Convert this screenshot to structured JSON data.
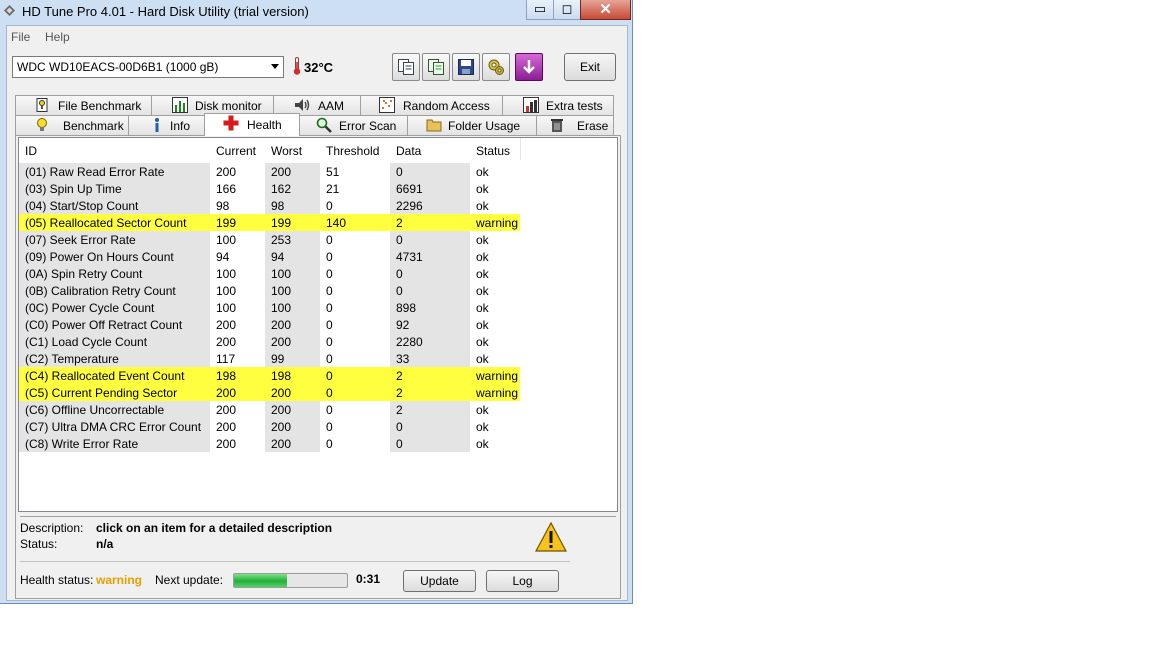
{
  "window": {
    "title": "HD Tune Pro 4.01 - Hard Disk Utility (trial version)"
  },
  "menu": {
    "file": "File",
    "help": "Help"
  },
  "toolbar": {
    "drive": "WDC WD10EACS-00D6B1 (1000 gB)",
    "temperature": "32°C",
    "exit_label": "Exit",
    "icons": [
      "copy-text-icon",
      "copy-info-icon",
      "save-icon",
      "options-icon",
      "screenshot-icon"
    ]
  },
  "tabs": {
    "top": [
      "File Benchmark",
      "Disk monitor",
      "AAM",
      "Random Access",
      "Extra tests"
    ],
    "bottom": [
      "Benchmark",
      "Info",
      "Health",
      "Error Scan",
      "Folder Usage",
      "Erase"
    ],
    "active": "Health"
  },
  "health": {
    "columns": [
      "ID",
      "Current",
      "Worst",
      "Threshold",
      "Data",
      "Status"
    ],
    "rows": [
      [
        "(01) Raw Read Error Rate",
        "200",
        "200",
        "51",
        "0",
        "ok"
      ],
      [
        "(03) Spin Up Time",
        "166",
        "162",
        "21",
        "6691",
        "ok"
      ],
      [
        "(04) Start/Stop Count",
        "98",
        "98",
        "0",
        "2296",
        "ok"
      ],
      [
        "(05) Reallocated Sector Count",
        "199",
        "199",
        "140",
        "2",
        "warning"
      ],
      [
        "(07) Seek Error Rate",
        "100",
        "253",
        "0",
        "0",
        "ok"
      ],
      [
        "(09) Power On Hours Count",
        "94",
        "94",
        "0",
        "4731",
        "ok"
      ],
      [
        "(0A) Spin Retry Count",
        "100",
        "100",
        "0",
        "0",
        "ok"
      ],
      [
        "(0B) Calibration Retry Count",
        "100",
        "100",
        "0",
        "0",
        "ok"
      ],
      [
        "(0C) Power Cycle Count",
        "100",
        "100",
        "0",
        "898",
        "ok"
      ],
      [
        "(C0) Power Off Retract Count",
        "200",
        "200",
        "0",
        "92",
        "ok"
      ],
      [
        "(C1) Load Cycle Count",
        "200",
        "200",
        "0",
        "2280",
        "ok"
      ],
      [
        "(C2) Temperature",
        "117",
        "99",
        "0",
        "33",
        "ok"
      ],
      [
        "(C4) Reallocated Event Count",
        "198",
        "198",
        "0",
        "2",
        "warning"
      ],
      [
        "(C5) Current Pending Sector",
        "200",
        "200",
        "0",
        "2",
        "warning"
      ],
      [
        "(C6) Offline Uncorrectable",
        "200",
        "200",
        "0",
        "2",
        "ok"
      ],
      [
        "(C7) Ultra DMA CRC Error Count",
        "200",
        "200",
        "0",
        "0",
        "ok"
      ],
      [
        "(C8) Write Error Rate",
        "200",
        "200",
        "0",
        "0",
        "ok"
      ]
    ],
    "warning_color": "#ffff40"
  },
  "details": {
    "description_label": "Description:",
    "description_value": "click on an item for a detailed description",
    "status_label": "Status:",
    "status_value": "n/a"
  },
  "footer": {
    "health_label": "Health status:",
    "health_value": "warning",
    "health_value_color": "#e8a000",
    "next_update_label": "Next update:",
    "progress_fraction": 0.47,
    "countdown": "0:31",
    "update_label": "Update",
    "log_label": "Log"
  }
}
